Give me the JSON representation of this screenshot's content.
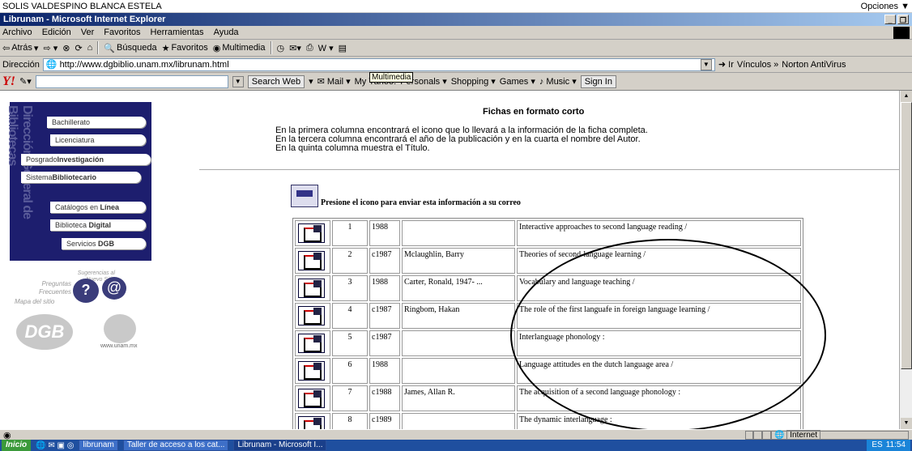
{
  "top": {
    "user": "SOLIS VALDESPINO BLANCA ESTELA",
    "options": "Opciones ▼"
  },
  "window": {
    "title": "Librunam - Microsoft Internet Explorer"
  },
  "menu": [
    "Archivo",
    "Edición",
    "Ver",
    "Favoritos",
    "Herramientas",
    "Ayuda"
  ],
  "toolbar": {
    "back": "Atrás",
    "search": "Búsqueda",
    "favorites": "Favoritos",
    "multimedia": "Multimedia"
  },
  "address": {
    "label": "Dirección",
    "url": "http://www.dgbiblio.unam.mx/librunam.html",
    "go": "Ir",
    "links": "Vínculos »",
    "norton": "Norton AntiVirus"
  },
  "yahoo": {
    "search_btn": "Search Web",
    "mail": "Mail",
    "myyahoo": "My Yahoo!",
    "personals": "Personals",
    "shopping": "Shopping",
    "games": "Games",
    "music": "Music",
    "signin": "Sign In"
  },
  "tooltip": "Multimedia",
  "sidebar": {
    "vertical_title": "Dirección General de Bibliotecas",
    "items": [
      {
        "text": "Bachillerato",
        "bold": ""
      },
      {
        "text": "Licenciatura",
        "bold": ""
      },
      {
        "text": "Posgrado",
        "bold": "Investigación"
      },
      {
        "text": "Sistema",
        "bold": "Bibliotecario"
      },
      {
        "text": "Catálogos en ",
        "bold": "Línea"
      },
      {
        "text": "Biblioteca ",
        "bold": "Digital"
      },
      {
        "text": "Servicios ",
        "bold": "DGB"
      }
    ],
    "faq": "Preguntas Frecuentes",
    "suggest": "Sugerencias al Nuevo Sitio",
    "map": "Mapa del sitio",
    "dgb": "DGB",
    "unam": "www.unam.mx"
  },
  "page": {
    "title": "Fichas en formato corto",
    "intro1": "En la primera columna encontrará el icono que lo llevará a la información de la ficha completa.",
    "intro2": "En la tercera columna encontrará el año de la publicación y en la cuarta el nombre del Autor.",
    "intro3": "En la quinta columna muestra el Título.",
    "mail_text": "Presione el icono para enviar esta información a su correo"
  },
  "records": [
    {
      "n": "1",
      "year": "1988",
      "author": "",
      "title": "Interactive approaches to second language reading /"
    },
    {
      "n": "2",
      "year": "c1987",
      "author": "Mclaughlin, Barry",
      "title": "Theories of second-language learning /"
    },
    {
      "n": "3",
      "year": "1988",
      "author": "Carter, Ronald, 1947- ...",
      "title": "Vocabulary and language teaching /"
    },
    {
      "n": "4",
      "year": "c1987",
      "author": "Ringbom, Hakan",
      "title": "The role of the first languafe in foreign language learning /"
    },
    {
      "n": "5",
      "year": "c1987",
      "author": "",
      "title": "Interlanguage phonology :"
    },
    {
      "n": "6",
      "year": "1988",
      "author": "",
      "title": "Language attitudes en the dutch language area /"
    },
    {
      "n": "7",
      "year": "c1988",
      "author": "James, Allan R.",
      "title": "The acquisition of a second language phonology :"
    },
    {
      "n": "8",
      "year": "c1989",
      "author": "",
      "title": "The dynamic interlanguage :"
    }
  ],
  "status": {
    "zone": "Internet"
  },
  "taskbar": {
    "start": "Inicio",
    "t1": "librunam",
    "t2": "Taller de acceso a los cat...",
    "t3": "Librunam - Microsoft I...",
    "lang": "ES",
    "time": "11:54"
  }
}
